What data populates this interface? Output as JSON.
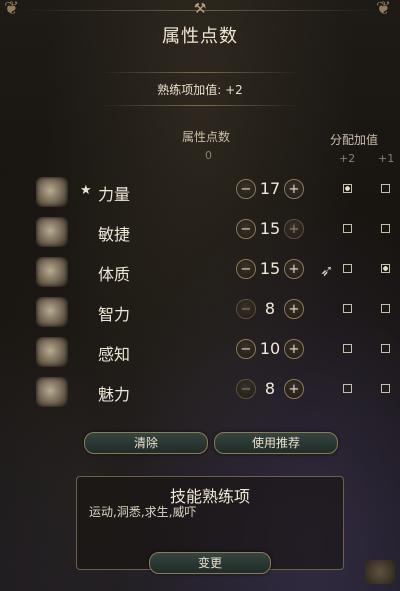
{
  "window": {
    "title": "属性点数"
  },
  "proficiency": {
    "label": "熟练项加值: +2"
  },
  "columns": {
    "ability_points_label": "属性点数",
    "ability_points_remaining": "0",
    "bonus_label": "分配加值",
    "bonus_plus2": "+2",
    "bonus_plus1": "+1"
  },
  "abilities": [
    {
      "name": "力量",
      "score": "17",
      "starred": true,
      "plus2_selected": true,
      "plus1_selected": false,
      "icon": "strength-arm-icon"
    },
    {
      "name": "敏捷",
      "score": "15",
      "starred": false,
      "plus2_selected": false,
      "plus1_selected": false,
      "icon": "dexterity-boot-icon"
    },
    {
      "name": "体质",
      "score": "15",
      "starred": false,
      "plus2_selected": false,
      "plus1_selected": true,
      "icon": "constitution-heart-icon"
    },
    {
      "name": "智力",
      "score": "8",
      "starred": false,
      "plus2_selected": false,
      "plus1_selected": false,
      "icon": "intelligence-book-icon"
    },
    {
      "name": "感知",
      "score": "10",
      "starred": false,
      "plus2_selected": false,
      "plus1_selected": false,
      "icon": "wisdom-owl-icon"
    },
    {
      "name": "魅力",
      "score": "8",
      "starred": false,
      "plus2_selected": false,
      "plus1_selected": false,
      "icon": "charisma-bird-icon"
    }
  ],
  "actions": {
    "clear": "清除",
    "use_recommended": "使用推荐"
  },
  "skills": {
    "title": "技能熟练项",
    "list": "运动,洞悉,求生,威吓",
    "change": "变更"
  },
  "glyphs": {
    "minus": "−",
    "plus": "+",
    "star": "★",
    "crest": "⚒",
    "cursor": "➶"
  },
  "colors": {
    "accent_gold": "#8c7a58",
    "button_teal": "#35453f",
    "text_light": "#efe7d6"
  }
}
